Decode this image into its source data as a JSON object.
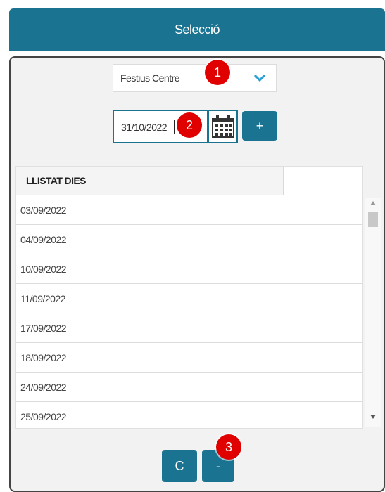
{
  "header": {
    "title": "Selecció"
  },
  "select": {
    "value": "Festius Centre"
  },
  "date": {
    "value": "31/10/2022"
  },
  "buttons": {
    "add": "+",
    "clear": "C",
    "remove": "-"
  },
  "list": {
    "header": "LLISTAT DIES",
    "rows": [
      "03/09/2022",
      "04/09/2022",
      "10/09/2022",
      "11/09/2022",
      "17/09/2022",
      "18/09/2022",
      "24/09/2022",
      "25/09/2022"
    ]
  },
  "badges": [
    "1",
    "2",
    "3"
  ],
  "colors": {
    "accent": "#1a7491",
    "badge": "#e00000"
  }
}
